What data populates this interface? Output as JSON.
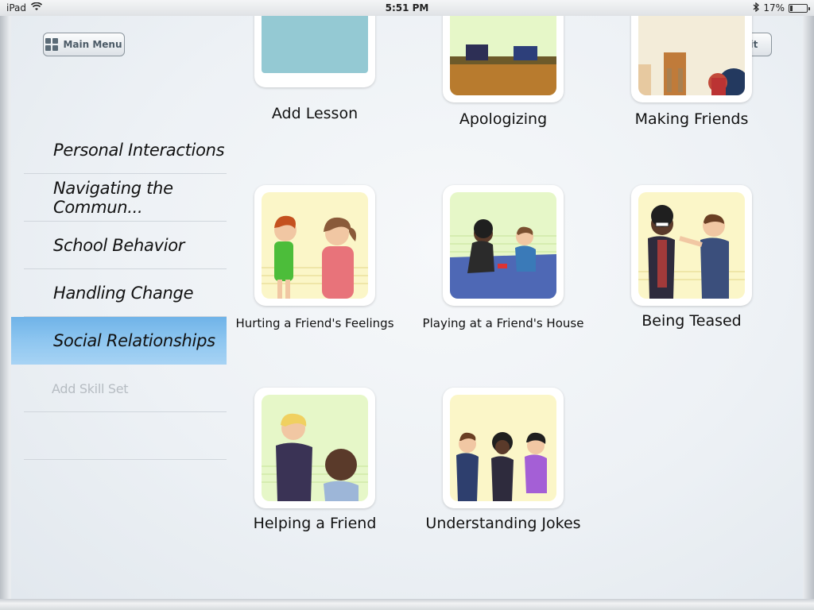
{
  "status": {
    "device": "iPad",
    "time": "5:51 PM",
    "battery": "17%",
    "battery_level": 0.17
  },
  "toolbar": {
    "menu_label": "Main Menu",
    "edit_label": "Edit"
  },
  "sidebar": {
    "items": [
      {
        "label": "Personal Interactions"
      },
      {
        "label": "Navigating the Commun..."
      },
      {
        "label": "School Behavior"
      },
      {
        "label": "Handling Change"
      },
      {
        "label": "Social Relationships",
        "selected": true
      }
    ],
    "add_label": "Add Skill Set"
  },
  "lessons": [
    {
      "label": "Add Lesson"
    },
    {
      "label": "Apologizing"
    },
    {
      "label": "Making Friends"
    },
    {
      "label": "Hurting a Friend's Feelings"
    },
    {
      "label": "Playing at a Friend's House"
    },
    {
      "label": "Being Teased"
    },
    {
      "label": "Helping a Friend"
    },
    {
      "label": "Understanding Jokes"
    }
  ],
  "colors": {
    "selected_row": "#8ec6f0",
    "tile_bg_yellow": "#fbf6c8",
    "tile_bg_green": "#e6f7c8",
    "add_lesson_teal": "#94c9d3"
  }
}
